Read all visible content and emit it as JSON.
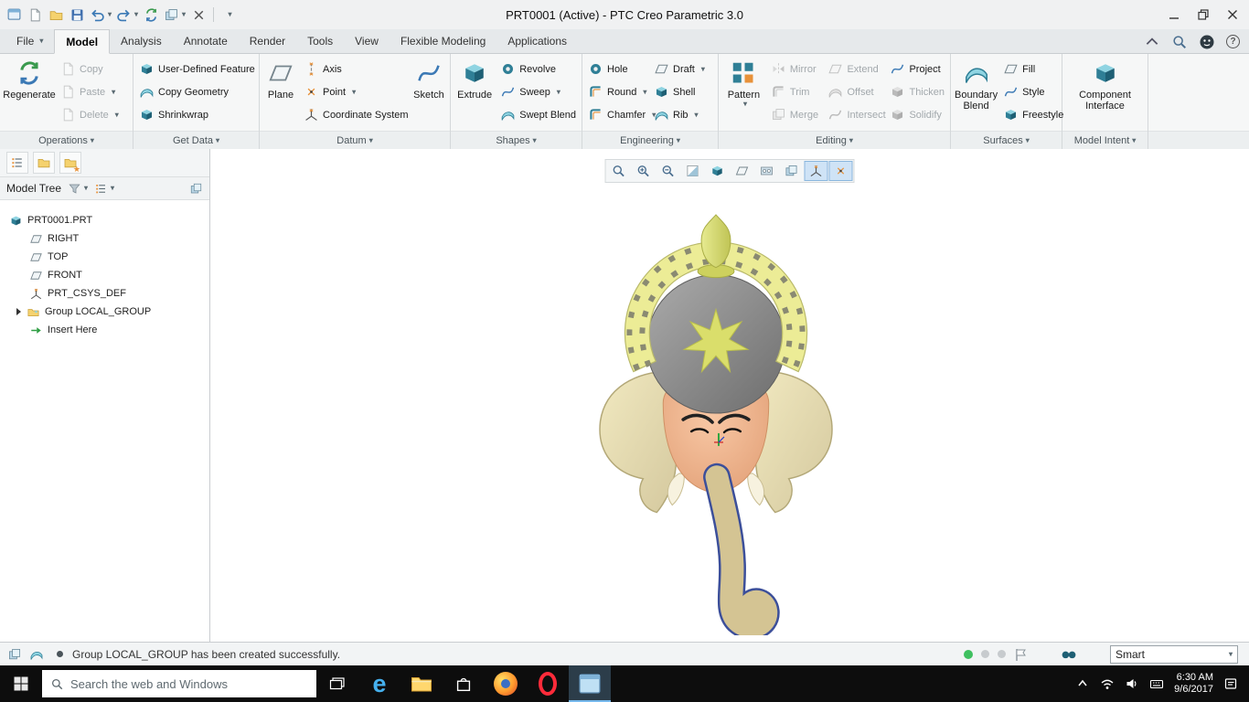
{
  "window": {
    "title": "PRT0001 (Active) - PTC Creo Parametric 3.0"
  },
  "tabs": {
    "file": "File",
    "model": "Model",
    "analysis": "Analysis",
    "annotate": "Annotate",
    "render": "Render",
    "tools": "Tools",
    "view": "View",
    "flexible_modeling": "Flexible Modeling",
    "applications": "Applications"
  },
  "ribbon": {
    "group_labels": {
      "operations": "Operations",
      "get_data": "Get Data",
      "datum": "Datum",
      "shapes": "Shapes",
      "engineering": "Engineering",
      "editing": "Editing",
      "surfaces": "Surfaces",
      "model_intent": "Model Intent"
    },
    "buttons": {
      "regenerate": "Regenerate",
      "copy": "Copy",
      "paste": "Paste",
      "delete": "Delete",
      "udf": "User-Defined Feature",
      "copy_geometry": "Copy Geometry",
      "shrinkwrap": "Shrinkwrap",
      "plane": "Plane",
      "axis": "Axis",
      "point": "Point",
      "csys": "Coordinate System",
      "sketch": "Sketch",
      "extrude": "Extrude",
      "revolve": "Revolve",
      "sweep": "Sweep",
      "swept_blend": "Swept Blend",
      "hole": "Hole",
      "round": "Round",
      "chamfer": "Chamfer",
      "draft": "Draft",
      "shell": "Shell",
      "rib": "Rib",
      "pattern": "Pattern",
      "mirror": "Mirror",
      "trim": "Trim",
      "merge": "Merge",
      "extend": "Extend",
      "offset": "Offset",
      "intersect": "Intersect",
      "project": "Project",
      "thicken": "Thicken",
      "solidify": "Solidify",
      "boundary_blend": "Boundary Blend",
      "fill": "Fill",
      "style": "Style",
      "freestyle": "Freestyle",
      "component_interface": "Component Interface"
    }
  },
  "tree": {
    "title": "Model Tree",
    "items": {
      "root": "PRT0001.PRT",
      "right": "RIGHT",
      "top": "TOP",
      "front": "FRONT",
      "csys": "PRT_CSYS_DEF",
      "group": "Group LOCAL_GROUP",
      "insert": "Insert Here"
    }
  },
  "status": {
    "message": "Group LOCAL_GROUP has been created successfully.",
    "filter": "Smart"
  },
  "taskbar": {
    "search_placeholder": "Search the web and Windows",
    "time": "6:30 AM",
    "date": "9/6/2017"
  },
  "colors": {
    "accent_teal": "#2f7f96",
    "accent_orange": "#e8923a",
    "disabled_text": "#a2a8ac",
    "status_green": "#3fc060",
    "taskbar_bg": "#0d0d0d"
  }
}
